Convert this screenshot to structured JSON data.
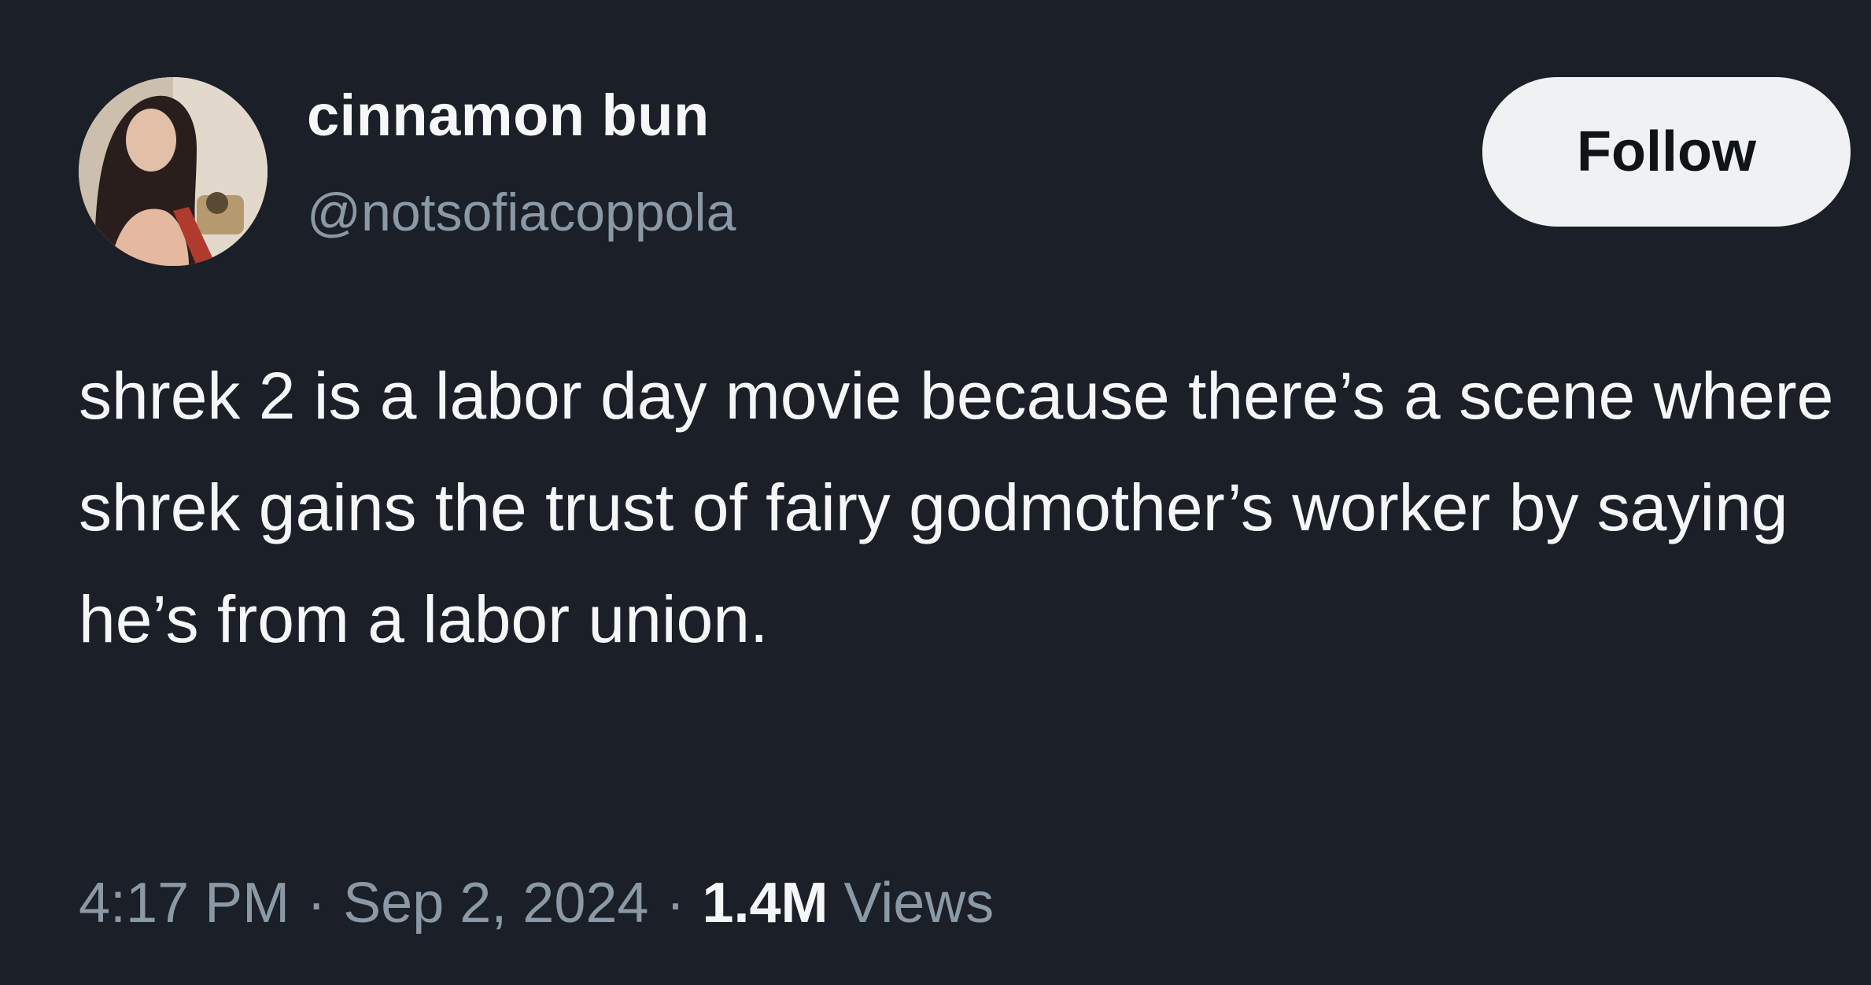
{
  "author": {
    "display_name": "cinnamon bun",
    "handle": "@notsofiacoppola"
  },
  "follow_button": {
    "label": "Follow"
  },
  "tweet": {
    "text": "shrek 2 is a labor day movie because there’s a scene where shrek gains the trust of fairy godmother’s worker by saying he’s from a labor union."
  },
  "meta": {
    "time": "4:17 PM",
    "separator": "·",
    "date": "Sep 2, 2024",
    "views_count": "1.4M",
    "views_label": "Views"
  },
  "colors": {
    "background": "#1b1f27",
    "primary_text": "#f4f6f8",
    "secondary_text": "#8b98a5",
    "button_background": "#eff1f3"
  }
}
